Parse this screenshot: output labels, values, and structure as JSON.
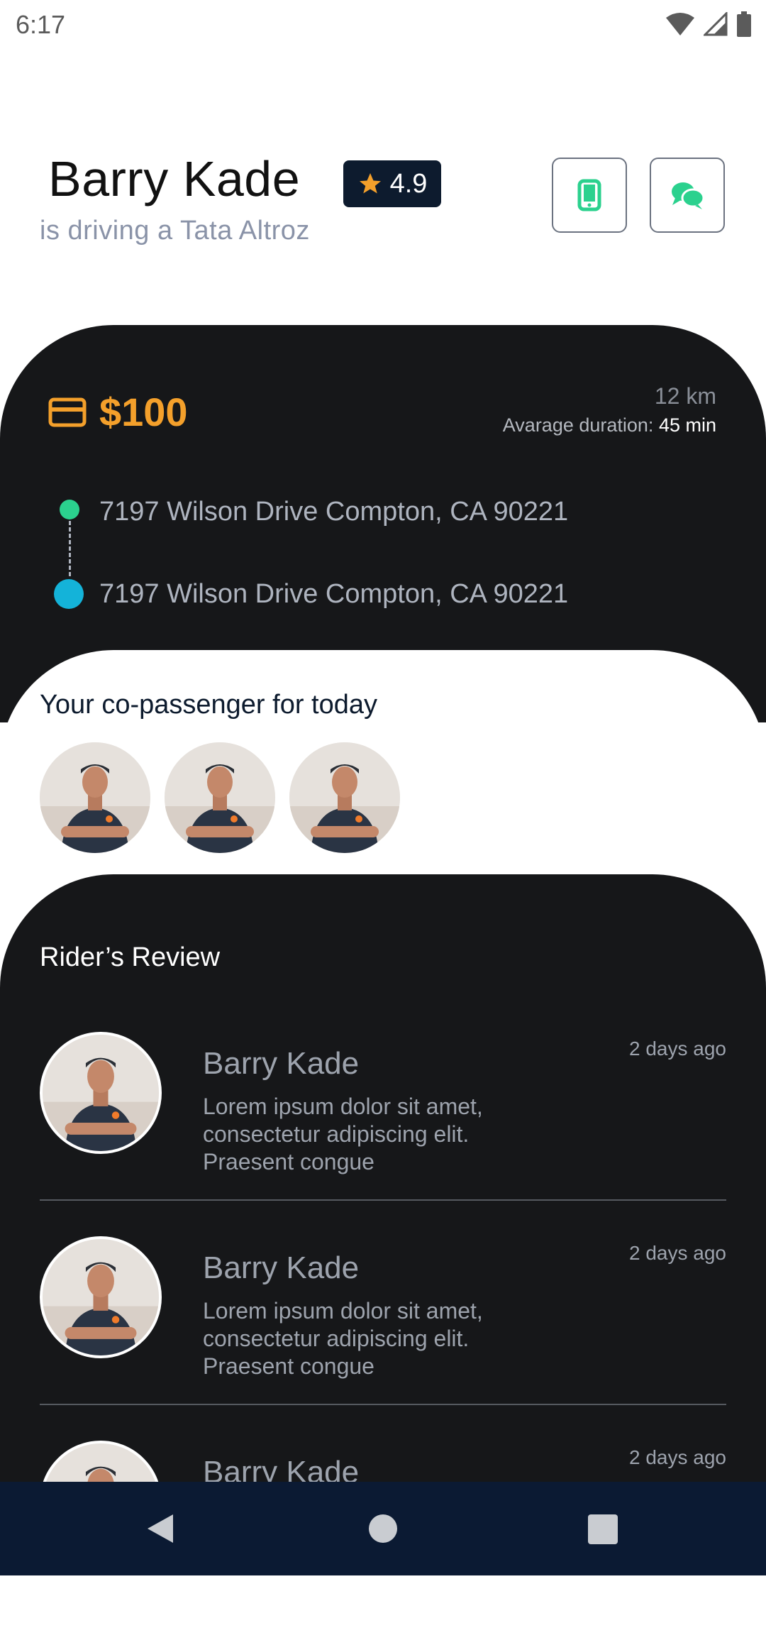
{
  "status_bar": {
    "time": "6:17"
  },
  "driver": {
    "name": "Barry Kade",
    "rating": "4.9",
    "vehicle_text": "is driving a Tata Altroz"
  },
  "actions": {
    "call_icon": "phone-icon",
    "chat_icon": "chat-icon"
  },
  "trip": {
    "fare": "$100",
    "distance": "12 km",
    "duration_label": "Avarage duration:",
    "duration_value": "45 min",
    "pickup": "7197 Wilson Drive Compton, CA 90221",
    "dropoff": "7197 Wilson Drive Compton, CA 90221"
  },
  "copassengers": {
    "title": "Your co-passenger for today",
    "count": 3
  },
  "reviews": {
    "title": "Rider’s Review",
    "items": [
      {
        "name": "Barry Kade",
        "time": "2 days ago",
        "text": "Lorem ipsum dolor sit amet, consectetur adipiscing elit. Praesent congue"
      },
      {
        "name": "Barry Kade",
        "time": "2 days ago",
        "text": "Lorem ipsum dolor sit amet, consectetur adipiscing elit. Praesent congue"
      },
      {
        "name": "Barry Kade",
        "time": "2 days ago",
        "text": ""
      }
    ]
  },
  "colors": {
    "accent_orange": "#f4a02b",
    "accent_green": "#2bd18e",
    "accent_blue": "#14b3d9",
    "dark_bg": "#161719",
    "navy": "#0d1b2e"
  }
}
